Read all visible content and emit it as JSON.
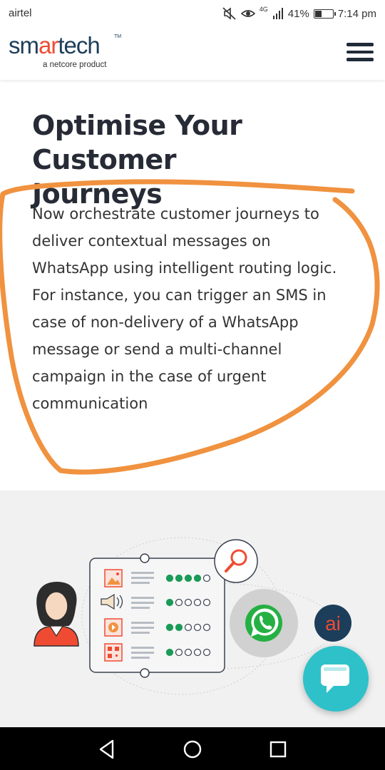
{
  "status_bar": {
    "carrier": "airtel",
    "network": "4G",
    "battery_percent": "41%",
    "battery_level": 0.41,
    "time": "7:14 pm",
    "icons": [
      "mute-icon",
      "eye-icon",
      "signal-icon",
      "battery-icon"
    ]
  },
  "header": {
    "logo_part1": "sm",
    "logo_part2": "ar",
    "logo_part3": "tech",
    "logo_tm": "TM",
    "logo_sub": "a netcore product",
    "menu_icon": "hamburger-menu-icon"
  },
  "content": {
    "headline_line1": "Optimise Your Customer",
    "headline_line2": "Journeys",
    "body_lines": [
      "Now orchestrate customer journeys to",
      "deliver contextual messages on",
      "WhatsApp using intelligent routing logic.",
      "For instance, you can trigger an SMS in",
      "case of non-delivery of a WhatsApp",
      "message or send a multi-channel",
      "campaign in the case of urgent",
      "communication"
    ],
    "annotation_color": "#f0923f"
  },
  "illustration": {
    "ai_badge": "ai",
    "channel_rows": [
      {
        "icon": "image-icon",
        "filled_dots": 4
      },
      {
        "icon": "megaphone-icon",
        "filled_dots": 1
      },
      {
        "icon": "play-icon",
        "filled_dots": 2
      },
      {
        "icon": "qr-code-icon",
        "filled_dots": 1
      }
    ],
    "accent_color": "#ef4b33",
    "dot_color": "#1a9b57",
    "whatsapp_color": "#25b043"
  },
  "chat_widget": {
    "icon": "chat-bubble-icon",
    "color": "#2ec1c9"
  },
  "nav_bar": {
    "icons": [
      "back-icon",
      "home-icon",
      "recents-icon"
    ]
  }
}
